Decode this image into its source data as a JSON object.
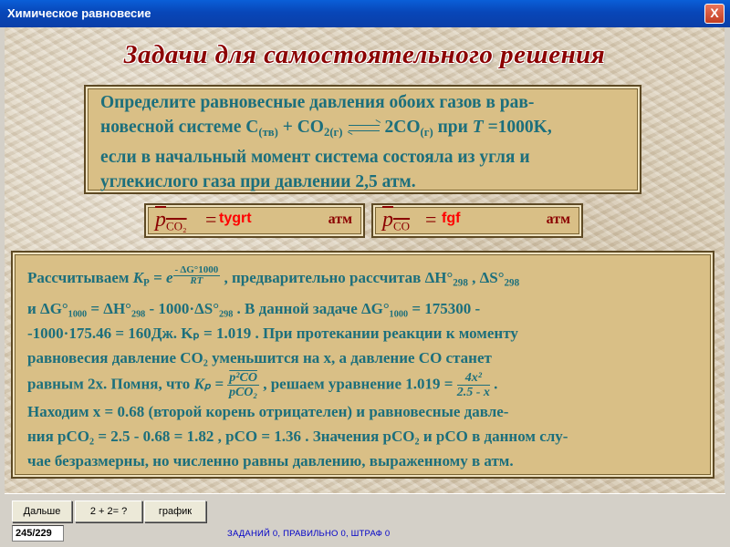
{
  "window": {
    "title": "Химическое равновесие",
    "close_glyph": "X"
  },
  "heading": "Задачи для самостоятельного решения",
  "task": {
    "line1": "Определите равновесные давления обоих газов в рав-",
    "line2_a": "новесной системе ",
    "c_solid": "C",
    "c_solid_sub": "(тв)",
    "plus": " + CO",
    "co2_sub": "2(г)",
    "right": "2CO",
    "co_sub": "(г)",
    "line2_b": " при ",
    "T": "T",
    "T_val": " =1000K,",
    "line3": "если в начальный момент система состояла из угля и",
    "line4": "углекислого газа при давлении 2,5 атм."
  },
  "answers": {
    "co2": {
      "symbol": "p",
      "sub": "CO₂",
      "eq": "=",
      "value": "tygrt",
      "unit": "атм"
    },
    "co": {
      "symbol": "p",
      "sub": "CO",
      "eq": "=",
      "value": "fgf",
      "unit": "атм"
    }
  },
  "solution": {
    "l1_a": "Рассчитываем ",
    "Kp": "K",
    "Kp_sub": "P",
    "l1_eq": " = e",
    "exp_num": "- ΔG°1000",
    "exp_den": "RT",
    "l1_b": " , предварительно рассчитав ΔH°",
    "l1_b_sub": "298",
    "l1_c": " ,  ΔS°",
    "l1_c_sub": "298",
    "l2": "и ΔG°₁₀₀₀ = ΔH°₂₉₈ - 1000·ΔS°₂₉₈ . В данной задаче  ΔG°₁₀₀₀ = 175300  -",
    "l3": "-1000·175.46 = 160Дж.  Kₚ = 1.019 . При протекании реакции к моменту",
    "l4": "равновесия давление CO₂ уменьшится на  x, а давление CO станет",
    "l5_a": "равным 2x. Помня, что ",
    "l5_kp": "Kₚ =",
    "l5_frac_num": "p²CO",
    "l5_frac_den": "pCO₂",
    "l5_b": " , решаем уравнение 1.019 = ",
    "l5_frac2_num": "4x²",
    "l5_frac2_den": "2.5 - x",
    "l5_c": " .",
    "l6": "Находим x = 0.68 (второй корень отрицателен) и равновесные давле-",
    "l7": "ния pCO₂ = 2.5 - 0.68 = 1.82 , pCO = 1.36 . Значения pCO₂ и pCO в данном слу-",
    "l8": "чае безразмерны, но численно равны давлению, выраженному в атм."
  },
  "buttons": {
    "next": "Дальше",
    "calc": "2 + 2= ?",
    "graph": "график"
  },
  "status": {
    "counter": "245/229",
    "line": "ЗАДАНИЙ 0,  ПРАВИЛЬНО 0, ШТРАФ 0"
  }
}
